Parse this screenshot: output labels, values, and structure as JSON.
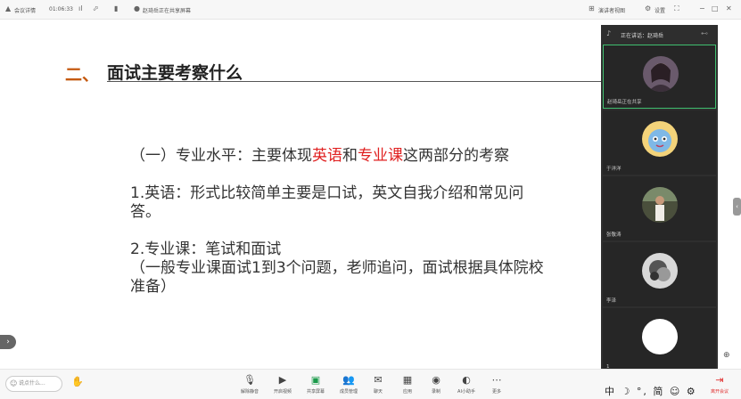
{
  "topbar": {
    "meeting_info": "会议详情",
    "timer": "01:06:33",
    "presenter": "赵琦岳正在共享屏幕",
    "view_mode": "演讲者视图",
    "settings": "设置"
  },
  "slide": {
    "title_number": "二、",
    "title": "面试主要考察什么",
    "line1_pre": "（一）专业水平：主要体现",
    "line1_red1": "英语",
    "line1_mid": "和",
    "line1_red2": "专业课",
    "line1_post": "这两部分的考察",
    "line2": "1.英语：形式比较简单主要是口试，英文自我介绍和常见问答。",
    "line3": "2.专业课：笔试和面试",
    "line4": "（一般专业课面试1到3个问题，老师追问，面试根据具体院校准备）"
  },
  "panel": {
    "header": "正在讲话：赵琦岳",
    "participants": [
      {
        "name": "赵琦岳正在共享"
      },
      {
        "name": "于洋洋"
      },
      {
        "name": "张敬涛"
      },
      {
        "name": "李泽"
      },
      {
        "name": "1"
      }
    ]
  },
  "bottombar": {
    "chat_placeholder": "说点什么...",
    "buttons": [
      "解除静音",
      "开启视频",
      "共享屏幕",
      "成员管理",
      "聊天",
      "应用",
      "录制",
      "AI小助手",
      "更多",
      "离开会议"
    ]
  },
  "ime": "中 ☽ °, 简 ☺ ⚙",
  "colors": {
    "accent_red": "#e02020",
    "title_orange": "#c55a11",
    "active_green": "#3fbf6f"
  }
}
